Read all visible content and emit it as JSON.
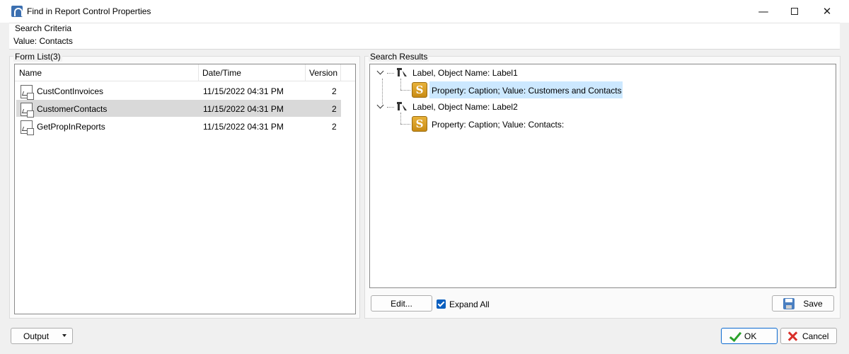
{
  "window": {
    "title": "Find in Report Control Properties",
    "controls": {
      "minimize": "—",
      "close": "✕"
    }
  },
  "criteria": {
    "title": "Search Criteria",
    "value": "Value: Contacts"
  },
  "form_list": {
    "title": "Form List(3)",
    "columns": [
      "Name",
      "Date/Time",
      "Version"
    ],
    "rows": [
      {
        "name": "CustContInvoices",
        "datetime": "11/15/2022 04:31 PM",
        "version": "2"
      },
      {
        "name": "CustomerContacts",
        "datetime": "11/15/2022 04:31 PM",
        "version": "2",
        "selected": true
      },
      {
        "name": "GetPropInReports",
        "datetime": "11/15/2022 04:31 PM",
        "version": "2"
      }
    ]
  },
  "results": {
    "title": "Search Results",
    "tree": [
      {
        "label": "Label, Object Name: Label1",
        "child": "Property: Caption; Value: Customers and Contacts",
        "child_selected": true
      },
      {
        "label": "Label, Object Name: Label2",
        "child": "Property: Caption; Value: Contacts:",
        "child_selected": false
      }
    ],
    "edit_label": "Edit...",
    "expand_all_label": "Expand All",
    "expand_all_checked": true,
    "save_label": "Save"
  },
  "footer": {
    "output_label": "Output",
    "ok_label": "OK",
    "cancel_label": "Cancel"
  },
  "icons": {
    "app": "report-app-icon",
    "row": "report-document-icon",
    "tree_label": "label-control-icon",
    "tree_property": "string-property-icon",
    "save": "floppy-disk-icon",
    "ok": "check-icon",
    "cancel": "x-icon"
  },
  "colors": {
    "selection_list": "#d9d9d9",
    "selection_tree": "#cce8ff",
    "checkbox": "#0b5fbf",
    "property_icon": "#d89e24"
  }
}
